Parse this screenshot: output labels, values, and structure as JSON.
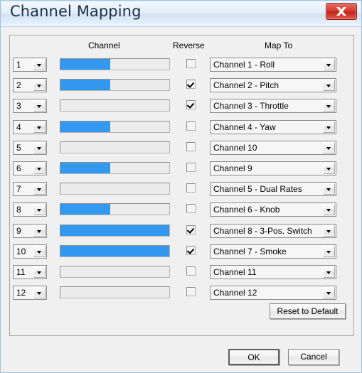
{
  "window": {
    "title": "Channel Mapping",
    "close_icon": "close-icon"
  },
  "headers": {
    "channel": "Channel",
    "reverse": "Reverse",
    "map_to": "Map To"
  },
  "colors": {
    "bar_fill": "#3399f0",
    "titlebar": "#dce9f7",
    "close_button": "#c22318",
    "dialog_background": "#f0f0f0"
  },
  "rows": [
    {
      "channel": "1",
      "bar_percent": 46,
      "reverse": false,
      "map_to": "Channel 1 - Roll"
    },
    {
      "channel": "2",
      "bar_percent": 46,
      "reverse": true,
      "map_to": "Channel 2 - Pitch"
    },
    {
      "channel": "3",
      "bar_percent": 0,
      "reverse": true,
      "map_to": "Channel 3 - Throttle"
    },
    {
      "channel": "4",
      "bar_percent": 46,
      "reverse": false,
      "map_to": "Channel 4 - Yaw"
    },
    {
      "channel": "5",
      "bar_percent": 0,
      "reverse": false,
      "map_to": "Channel 10"
    },
    {
      "channel": "6",
      "bar_percent": 46,
      "reverse": false,
      "map_to": "Channel 9"
    },
    {
      "channel": "7",
      "bar_percent": 0,
      "reverse": false,
      "map_to": "Channel 5 - Dual Rates"
    },
    {
      "channel": "8",
      "bar_percent": 46,
      "reverse": false,
      "map_to": "Channel 6 - Knob"
    },
    {
      "channel": "9",
      "bar_percent": 100,
      "reverse": true,
      "map_to": "Channel 8 - 3-Pos. Switch"
    },
    {
      "channel": "10",
      "bar_percent": 100,
      "reverse": true,
      "map_to": "Channel 7 - Smoke"
    },
    {
      "channel": "11",
      "bar_percent": 0,
      "reverse": false,
      "map_to": "Channel 11"
    },
    {
      "channel": "12",
      "bar_percent": 0,
      "reverse": false,
      "map_to": "Channel 12"
    }
  ],
  "buttons": {
    "reset": "Reset to Default",
    "ok": "OK",
    "cancel": "Cancel"
  }
}
